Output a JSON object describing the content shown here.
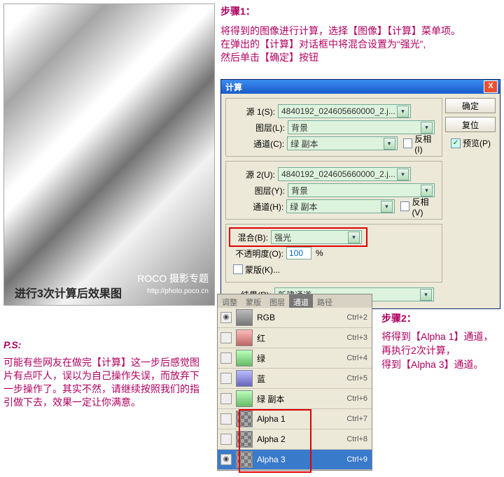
{
  "photo": {
    "watermark": "ROCO 摄影专题",
    "watermark_sub": "http://photo.poco.cn",
    "caption": "进行3次计算后效果图"
  },
  "step1": {
    "heading": "步骤1：",
    "line1": "将得到的图像进行计算，选择【图像】【计算】菜单项。",
    "line2": "在弹出的【计算】对话框中将混合设置为“强光”,",
    "line3": "然后单击【确定】按钮"
  },
  "dialog": {
    "title": "计算",
    "close_x": "X",
    "buttons": {
      "ok": "确定",
      "reset": "复位",
      "preview_label": "预览(P)"
    },
    "src1": {
      "label": "源 1(S):",
      "value": "4840192_024605660000_2.j...",
      "layer_label": "图层(L):",
      "layer_value": "背景",
      "channel_label": "通道(C):",
      "channel_value": "绿 副本",
      "invert_label": "反相(I)"
    },
    "src2": {
      "label": "源 2(U):",
      "value": "4840192_024605660000_2.j...",
      "layer_label": "图层(Y):",
      "layer_value": "背景",
      "channel_label": "通道(H):",
      "channel_value": "绿 副本",
      "invert_label": "反相(V)"
    },
    "blend": {
      "label": "混合(B):",
      "value": "强光"
    },
    "opacity": {
      "label": "不透明度(O):",
      "value": "100",
      "pct": "%"
    },
    "mask": {
      "label": "蒙版(K)..."
    },
    "result": {
      "label": "结果(R):",
      "value": "新建通道"
    }
  },
  "ps": {
    "heading": "P.S:",
    "body": "可能有些网友在做完【计算】这一步后感觉图片有点吓人，误以为自己操作失误，而放弃下一步操作了。其实不然，请继续按照我们的指引做下去，效果一定让你满意。"
  },
  "channels": {
    "tabs": [
      "调整",
      "蒙版",
      "图层",
      "通道",
      "路径"
    ],
    "active_tab": 3,
    "rows": [
      {
        "name": "RGB",
        "thumb": "c",
        "sc": "Ctrl+2",
        "eye": true
      },
      {
        "name": "红",
        "thumb": "r",
        "sc": "Ctrl+3"
      },
      {
        "name": "绿",
        "thumb": "g",
        "sc": "Ctrl+4"
      },
      {
        "name": "蓝",
        "thumb": "b",
        "sc": "Ctrl+5"
      },
      {
        "name": "绿 副本",
        "thumb": "g",
        "sc": "Ctrl+6"
      },
      {
        "name": "Alpha 1",
        "thumb": "alpha",
        "sc": "Ctrl+7"
      },
      {
        "name": "Alpha 2",
        "thumb": "alpha",
        "sc": "Ctrl+8"
      },
      {
        "name": "Alpha 3",
        "thumb": "alpha",
        "sc": "Ctrl+9",
        "selected": true,
        "eye": true
      }
    ]
  },
  "step2": {
    "heading": "步骤2：",
    "line1": "将得到【Alpha 1】通道，",
    "line2": "再执行2次计算，",
    "line3": "得到【Alpha 3】通道。"
  }
}
